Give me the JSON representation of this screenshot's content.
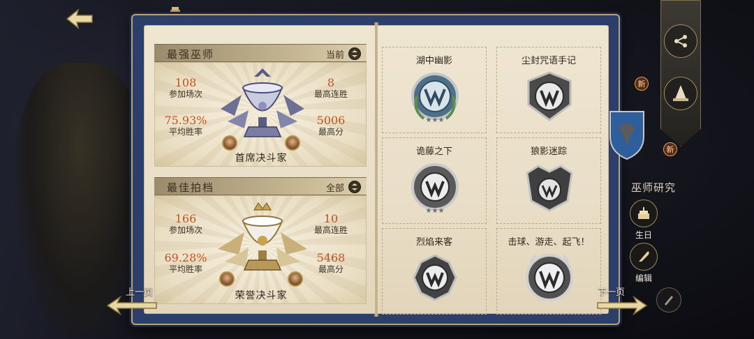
{
  "left_page": {
    "strongest": {
      "title": "最强巫师",
      "filter_label": "当前",
      "stats": {
        "matches_value": "108",
        "matches_label": "参加场次",
        "streak_value": "8",
        "streak_label": "最高连胜",
        "winrate_value": "75.93%",
        "winrate_label": "平均胜率",
        "score_value": "5006",
        "score_label": "最高分"
      },
      "rank_title": "首席决斗家"
    },
    "partner": {
      "title": "最佳拍档",
      "filter_label": "全部",
      "stats": {
        "matches_value": "166",
        "matches_label": "参加场次",
        "streak_value": "10",
        "streak_label": "最高连胜",
        "winrate_value": "69.28%",
        "winrate_label": "平均胜率",
        "score_value": "5468",
        "score_label": "最高分"
      },
      "rank_title": "荣誉决斗家"
    }
  },
  "right_page": {
    "badges": [
      {
        "name": "湖中幽影",
        "style": "colored"
      },
      {
        "name": "尘封咒语手记",
        "style": "silver"
      },
      {
        "name": "诡藤之下",
        "style": "silver"
      },
      {
        "name": "狼影迷踪",
        "style": "silver"
      },
      {
        "name": "烈焰来客",
        "style": "silver"
      },
      {
        "name": "击球、游走、起飞！",
        "style": "silver"
      }
    ]
  },
  "nav": {
    "prev_label": "上一页",
    "next_label": "下一页"
  },
  "side": {
    "new_label": "新",
    "research_label": "巫师研究",
    "birthday_label": "生日",
    "edit_label": "编辑"
  },
  "colors": {
    "stat_value": "#c0521f",
    "book_cover": "#2c3f6b",
    "parchment": "#efe6d2"
  }
}
